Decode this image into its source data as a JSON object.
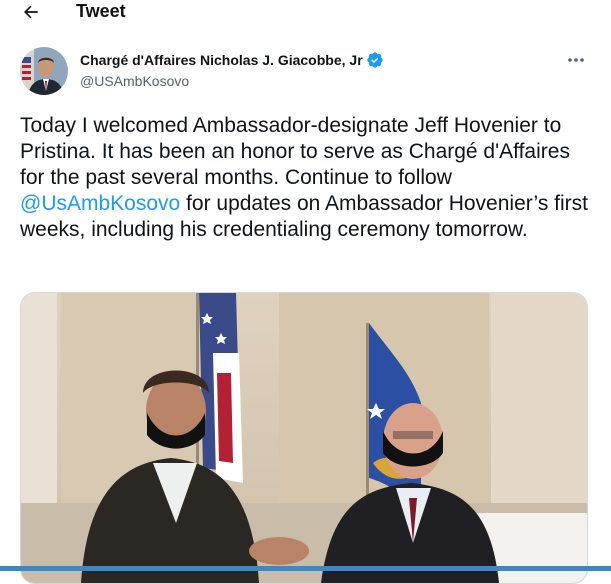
{
  "header": {
    "title": "Tweet"
  },
  "author": {
    "name": "Chargé d'Affaires Nicholas J. Giacobbe, Jr",
    "handle": "@USAmbKosovo",
    "verified": true
  },
  "tweet": {
    "text_before": "Today I welcomed Ambassador-designate Jeff Hovenier to Pristina. It has been an honor to serve as Chargé d'Affaires for the past several months. Continue to follow ",
    "mention": "@UsAmbKosovo",
    "text_after": " for updates on Ambassador Hovenier’s first weeks, including his credentialing ceremony tomorrow."
  },
  "icons": {
    "back": "arrow-left-icon",
    "verified": "verified-badge-icon",
    "more": "more-horizontal-icon"
  },
  "colors": {
    "accent": "#1d9bf0",
    "text": "#0f1419",
    "secondary": "#536471",
    "border": "#cfd9de"
  }
}
